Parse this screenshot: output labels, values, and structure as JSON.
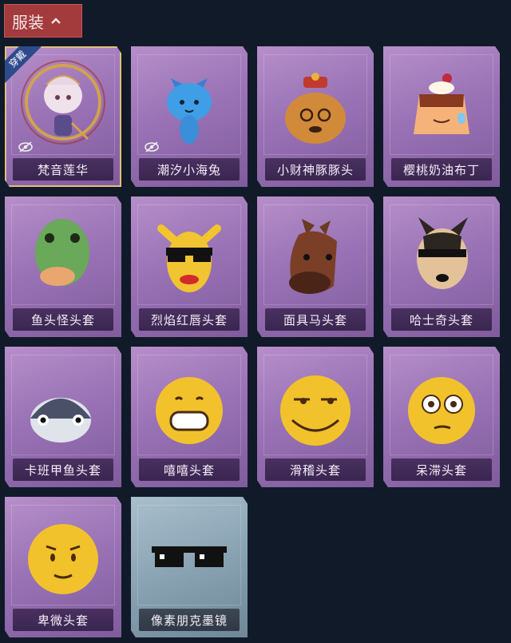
{
  "header": {
    "title": "服装",
    "icon": "chevron-up-icon"
  },
  "badges": {
    "equipped": "穿戴"
  },
  "items": [
    {
      "name": "梵音莲华",
      "equipped": true,
      "hidden_icon": true
    },
    {
      "name": "潮汐小海兔",
      "hidden_icon": true
    },
    {
      "name": "小财神豚豚头"
    },
    {
      "name": "樱桃奶油布丁"
    },
    {
      "name": "鱼头怪头套"
    },
    {
      "name": "烈焰红唇头套"
    },
    {
      "name": "面具马头套"
    },
    {
      "name": "哈士奇头套"
    },
    {
      "name": "卡班甲鱼头套"
    },
    {
      "name": "嘻嘻头套"
    },
    {
      "name": "滑稽头套"
    },
    {
      "name": "呆滞头套"
    },
    {
      "name": "卑微头套"
    },
    {
      "name": "像素朋克墨镜"
    }
  ]
}
